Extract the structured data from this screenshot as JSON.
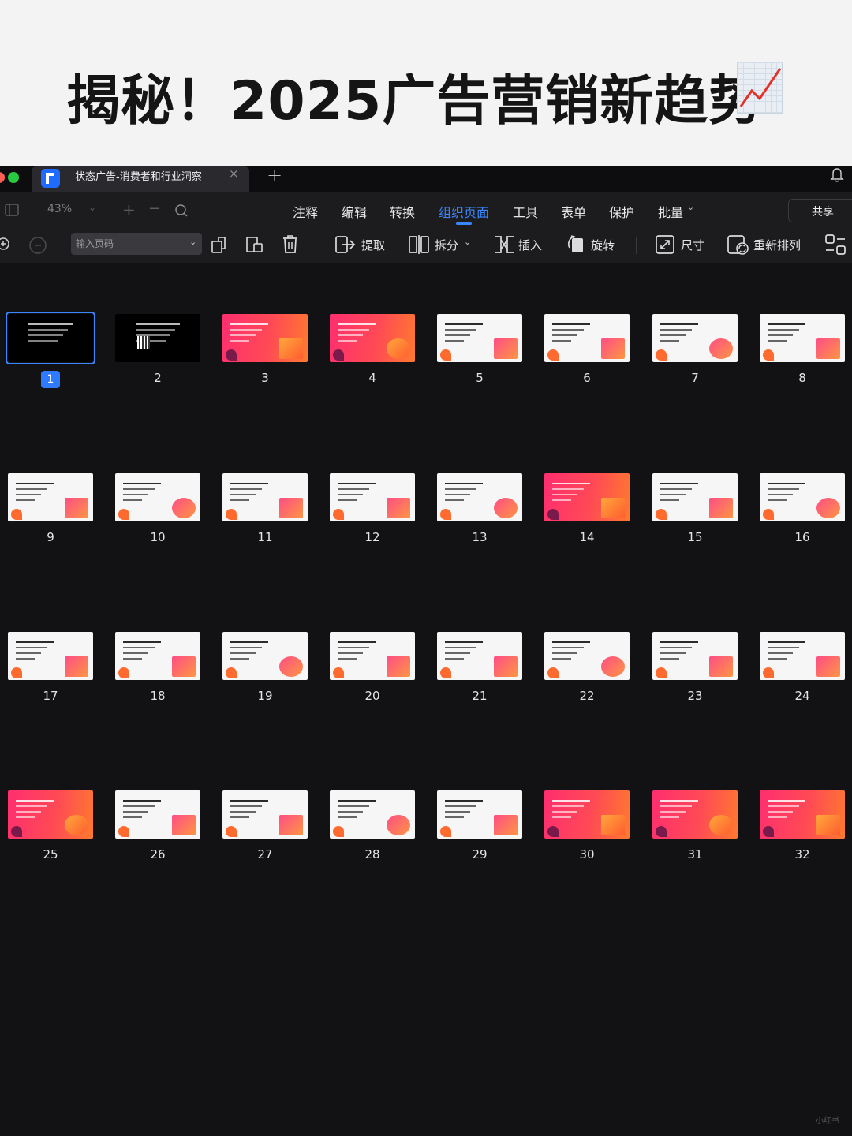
{
  "banner": {
    "title": "揭秘！2025广告营销新趋势"
  },
  "window": {
    "tab_label": "状态广告-消费者和行业洞察",
    "tab_close": "×",
    "new_tab": "+"
  },
  "menubar": {
    "zoom": "43%",
    "items": [
      "注释",
      "编辑",
      "转换",
      "组织页面",
      "工具",
      "表单",
      "保护",
      "批量"
    ],
    "active": "组织页面",
    "share": "共享"
  },
  "toolbar": {
    "page_input_placeholder": "输入页码",
    "extract": "提取",
    "split": "拆分",
    "insert": "插入",
    "rotate": "旋转",
    "size": "尺寸",
    "rearrange": "重新排列"
  },
  "thumbnails": {
    "selected": "1",
    "pages": [
      "1",
      "2",
      "3",
      "4",
      "5",
      "6",
      "7",
      "8",
      "9",
      "10",
      "11",
      "12",
      "13",
      "14",
      "15",
      "16",
      "17",
      "18",
      "19",
      "20",
      "21",
      "22",
      "23",
      "24",
      "25",
      "26",
      "27",
      "28",
      "29",
      "30",
      "31",
      "32"
    ],
    "styles": [
      "dark",
      "dark",
      "pink",
      "pink",
      "light",
      "light",
      "light",
      "light",
      "light",
      "light",
      "light",
      "light",
      "light",
      "pink",
      "light",
      "light",
      "light",
      "light",
      "light",
      "light",
      "light",
      "light",
      "light",
      "light",
      "pink",
      "light",
      "light",
      "light",
      "light",
      "pink",
      "pink",
      "pink"
    ]
  },
  "colors": {
    "accent": "#3a86ff",
    "brand_pink": "#ff2e6f",
    "brand_orange": "#ff7a2e",
    "background": "#121214"
  },
  "watermark": "小红书"
}
